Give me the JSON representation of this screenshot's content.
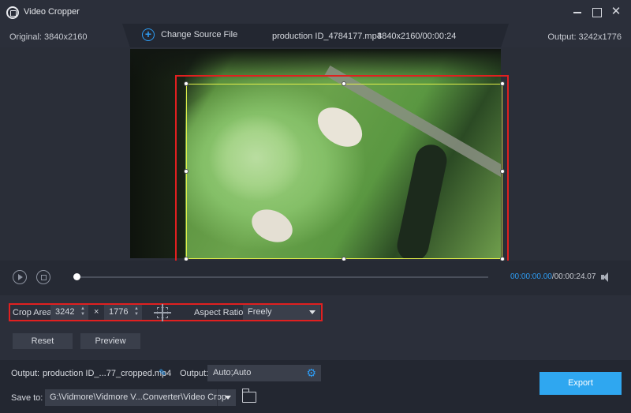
{
  "app": {
    "title": "Video Cropper",
    "close_glyph": "✕"
  },
  "info": {
    "original": "Original: 3840x2160",
    "change_source": "Change Source File",
    "file_name": "production ID_4784177.mp4",
    "file_meta": "3840x2160/00:00:24",
    "output": "Output: 3242x1776"
  },
  "playback": {
    "current_time": "00:00:00.00",
    "total_time": "/00:00:24.07",
    "progress": 0
  },
  "crop": {
    "crop_area_label": "Crop Area:",
    "width": "3242",
    "times": "×",
    "height": "1776",
    "spin_up": "▲",
    "spin_down": "▼",
    "aspect_label": "Aspect Ratio:",
    "aspect_value": "Freely",
    "reset_label": "Reset",
    "preview_label": "Preview"
  },
  "bottom": {
    "output_label": "Output:",
    "output_name": "production ID_...77_cropped.mp4",
    "edit_glyph": "✎",
    "output_format_label": "Output:",
    "output_format": "Auto;Auto",
    "gear_glyph": "⚙",
    "save_label": "Save to:",
    "save_path": "G:\\Vidmore\\Vidmore V...Converter\\Video Crop",
    "export_label": "Export"
  },
  "colors": {
    "accent": "#2e9cf3",
    "highlight": "#e02020",
    "crop_border": "#e3ef4a"
  },
  "icons": [
    "app-logo-icon",
    "minimize-icon",
    "maximize-icon",
    "close-icon",
    "plus-circle-icon",
    "play-icon",
    "stop-icon",
    "volume-icon",
    "crosshair-icon",
    "edit-icon",
    "gear-icon",
    "folder-icon",
    "chevron-down-icon"
  ]
}
